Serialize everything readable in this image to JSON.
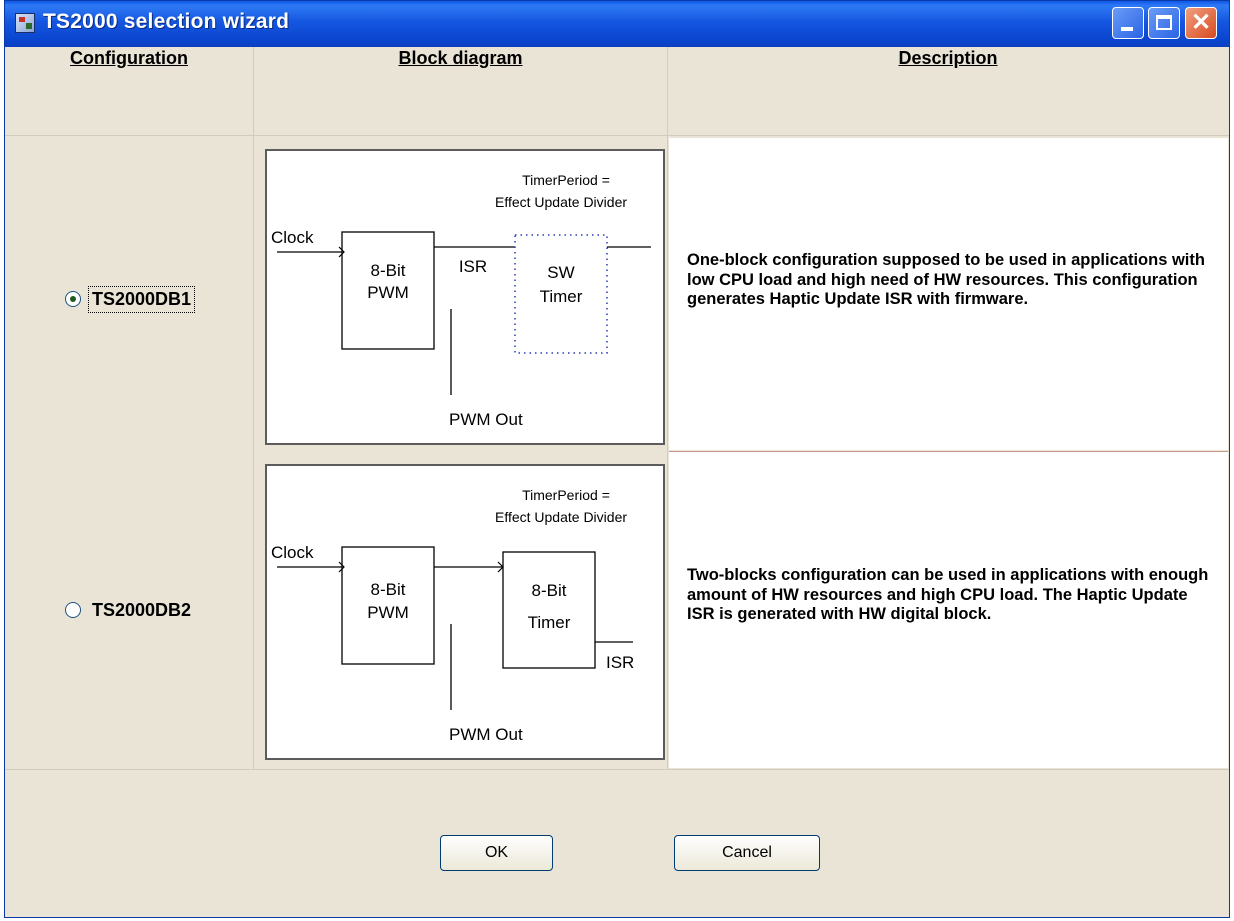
{
  "window": {
    "title": "TS2000 selection wizard"
  },
  "headers": {
    "configuration": "Configuration",
    "block_diagram": "Block diagram",
    "description": "Description"
  },
  "rows": [
    {
      "option": "TS2000DB1",
      "selected": true,
      "description": "One-block configuration supposed to be used in applications with low CPU load and high need of HW resources. This configuration generates Haptic Update ISR with firmware.",
      "diagram": {
        "timer_period_line1": "TimerPeriod =",
        "timer_period_line2": "Effect Update Divider",
        "clock": "Clock",
        "pwm_line1": "8-Bit",
        "pwm_line2": "PWM",
        "isr": "ISR",
        "block2_line1": "SW",
        "block2_line2": "Timer",
        "pwm_out": "PWM Out"
      }
    },
    {
      "option": "TS2000DB2",
      "selected": false,
      "description": "Two-blocks configuration can be used in applications with enough amount of HW resources and high CPU load. The Haptic Update ISR is generated with HW digital block.",
      "diagram": {
        "timer_period_line1": "TimerPeriod =",
        "timer_period_line2": "Effect Update Divider",
        "clock": "Clock",
        "pwm_line1": "8-Bit",
        "pwm_line2": "PWM",
        "block2_line1": "8-Bit",
        "block2_line2": "Timer",
        "isr": "ISR",
        "pwm_out": "PWM Out"
      }
    }
  ],
  "buttons": {
    "ok": "OK",
    "cancel": "Cancel"
  },
  "colors": {
    "titlebar": "#0a45cf",
    "dialog_bg": "#e9e4d6",
    "selected_radio": "#1e5a22"
  }
}
